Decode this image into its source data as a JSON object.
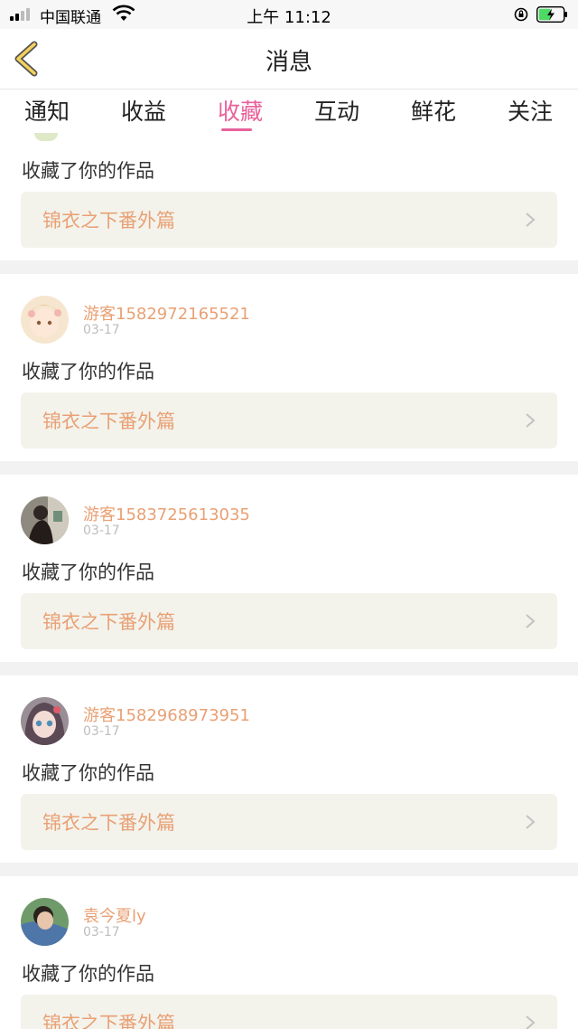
{
  "status": {
    "carrier": "中国联通",
    "time": "上午 11:12"
  },
  "header": {
    "title": "消息"
  },
  "tabs": [
    {
      "label": "通知"
    },
    {
      "label": "收益"
    },
    {
      "label": "收藏",
      "active": true
    },
    {
      "label": "互动"
    },
    {
      "label": "鲜花"
    },
    {
      "label": "关注"
    }
  ],
  "colors": {
    "accent": "#e8619b",
    "username": "#e9a074",
    "work_box": "#f3f3ec"
  },
  "notifications": [
    {
      "user": "",
      "date": "",
      "action": "收藏了你的作品",
      "work": "锦衣之下番外篇"
    },
    {
      "user": "游客1582972165521",
      "date": "03-17",
      "action": "收藏了你的作品",
      "work": "锦衣之下番外篇"
    },
    {
      "user": "游客1583725613035",
      "date": "03-17",
      "action": "收藏了你的作品",
      "work": "锦衣之下番外篇"
    },
    {
      "user": "游客1582968973951",
      "date": "03-17",
      "action": "收藏了你的作品",
      "work": "锦衣之下番外篇"
    },
    {
      "user": "袁今夏ly",
      "date": "03-17",
      "action": "收藏了你的作品",
      "work": "锦衣之下番外篇"
    }
  ]
}
